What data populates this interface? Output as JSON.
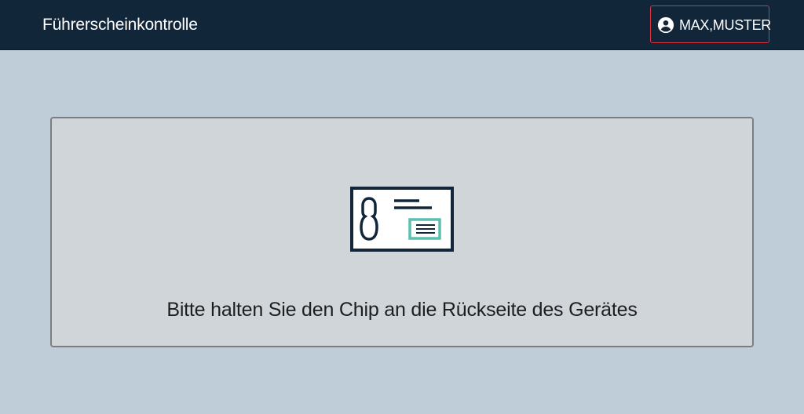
{
  "header": {
    "title": "Führerscheinkontrolle",
    "user": {
      "name": "MAX,MUSTER",
      "icon": "account-circle-icon"
    }
  },
  "main": {
    "card": {
      "icon": "id-card-icon",
      "message": "Bitte halten Sie den Chip an die Rückseite des Gerätes"
    }
  },
  "colors": {
    "header_bg": "#12263a",
    "page_bg": "#bfcdd8",
    "card_bg": "#d0d5da",
    "accent_red": "#d7343f",
    "icon_dark": "#12263a",
    "icon_teal": "#5cbfb0"
  }
}
